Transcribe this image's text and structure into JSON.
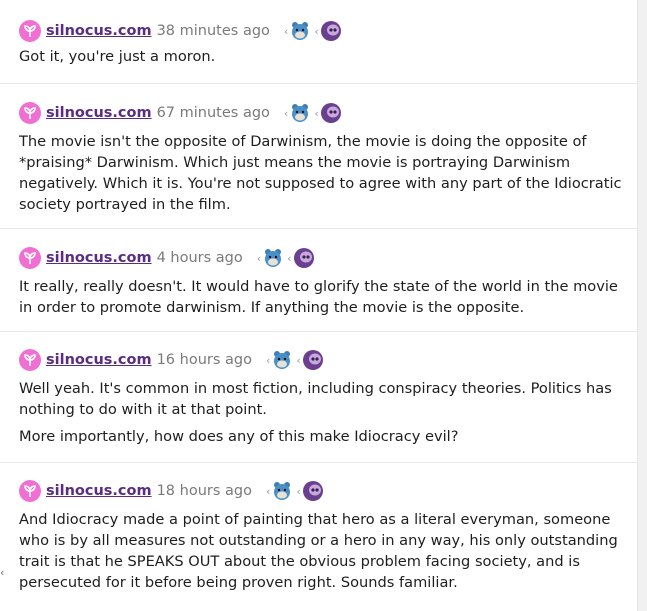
{
  "comments": [
    {
      "user": "silnocus.com",
      "time": "38 minutes ago",
      "paragraphs": [
        "Got it, you're just a moron."
      ]
    },
    {
      "user": "silnocus.com",
      "time": "67 minutes ago",
      "paragraphs": [
        "The movie isn't the opposite of Darwinism, the movie is doing the opposite of *praising* Darwinism. Which just means the movie is portraying Darwinism negatively. Which it is. You're not supposed to agree with any part of the Idiocratic society portrayed in the film."
      ]
    },
    {
      "user": "silnocus.com",
      "time": "4 hours ago",
      "paragraphs": [
        "It really, really doesn't. It would have to glorify the state of the world in the movie in order to promote darwinism. If anything the movie is the opposite."
      ]
    },
    {
      "user": "silnocus.com",
      "time": "16 hours ago",
      "paragraphs": [
        "Well yeah. It's common in most fiction, including conspiracy theories. Politics has nothing to do with it at that point.",
        "More importantly, how does any of this make Idiocracy evil?"
      ]
    },
    {
      "user": "silnocus.com",
      "time": "18 hours ago",
      "paragraphs": [
        "And Idiocracy made a point of painting that hero as a literal everyman, someone who is by all measures not outstanding or a hero in any way, his only outstanding trait is that he SPEAKS OUT about the obvious problem facing society, and is persecuted for it before being proven right. Sounds familiar."
      ]
    }
  ],
  "icons": {
    "avatar": "sprout-icon",
    "reaction_1": "blue-bear-emoji-icon",
    "reaction_2": "purple-skull-emoji-icon",
    "collapse": "chevron-left-icon"
  },
  "colors": {
    "avatar_bg": "#f06fd2",
    "username": "#5a2d82",
    "timestamp": "#7a7a7a"
  }
}
